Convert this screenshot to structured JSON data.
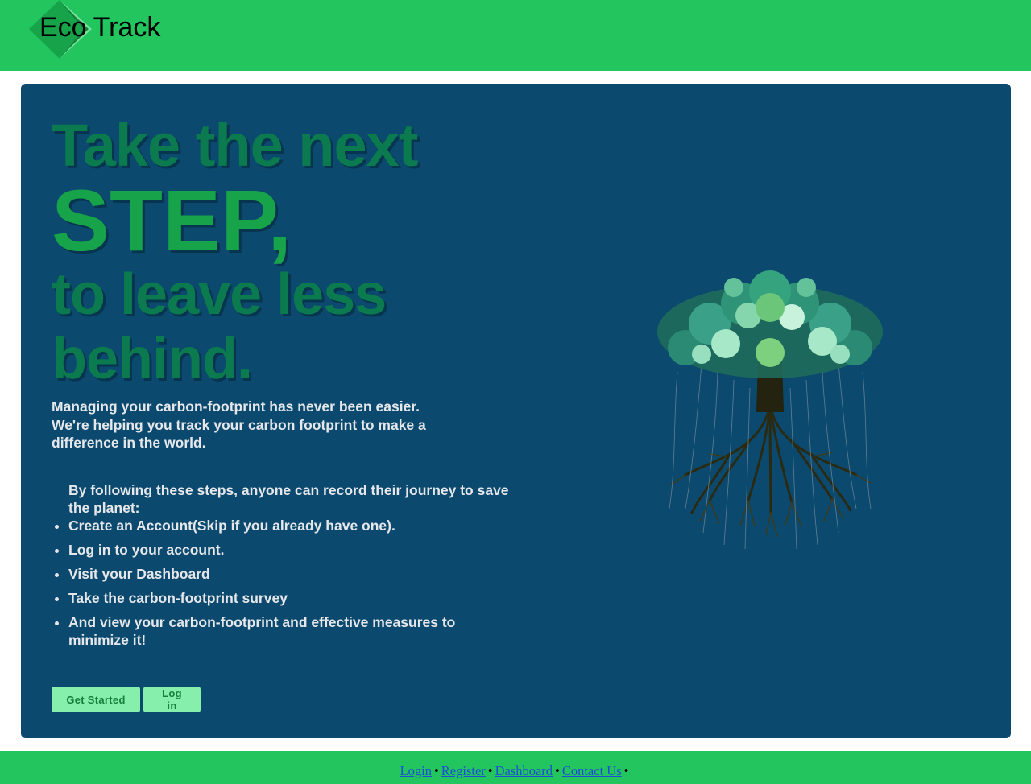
{
  "brand": {
    "name_part1": "Eco",
    "name_part2": "Track",
    "logo_icon": "diamond-logo-icon",
    "colors": {
      "primary_green": "#22c55e",
      "hero_blue": "#0b4a6e"
    }
  },
  "hero": {
    "headline_line1": "Take the next",
    "headline_line2": "STEP,",
    "headline_line3": "to leave less",
    "headline_line4": "behind.",
    "intro_line1": "Managing your carbon-footprint has never been easier.",
    "intro_line2": "We're helping you track your carbon footprint to make a difference in the world.",
    "steps_lead": "By following these steps, anyone can record their journey to save the planet:",
    "steps": [
      "Create an Account(Skip if you already have one).",
      "Log in to your account.",
      "Visit your Dashboard",
      "Take the carbon-footprint survey",
      "And view your carbon-footprint and effective measures to minimize it!"
    ],
    "get_started_label": "Get Started",
    "login_label": "Log in",
    "illustration": "tree-with-roots-illustration"
  },
  "footer": {
    "links": [
      "Login",
      "Register",
      "Dashboard",
      "Contact Us"
    ],
    "separator": "•"
  }
}
